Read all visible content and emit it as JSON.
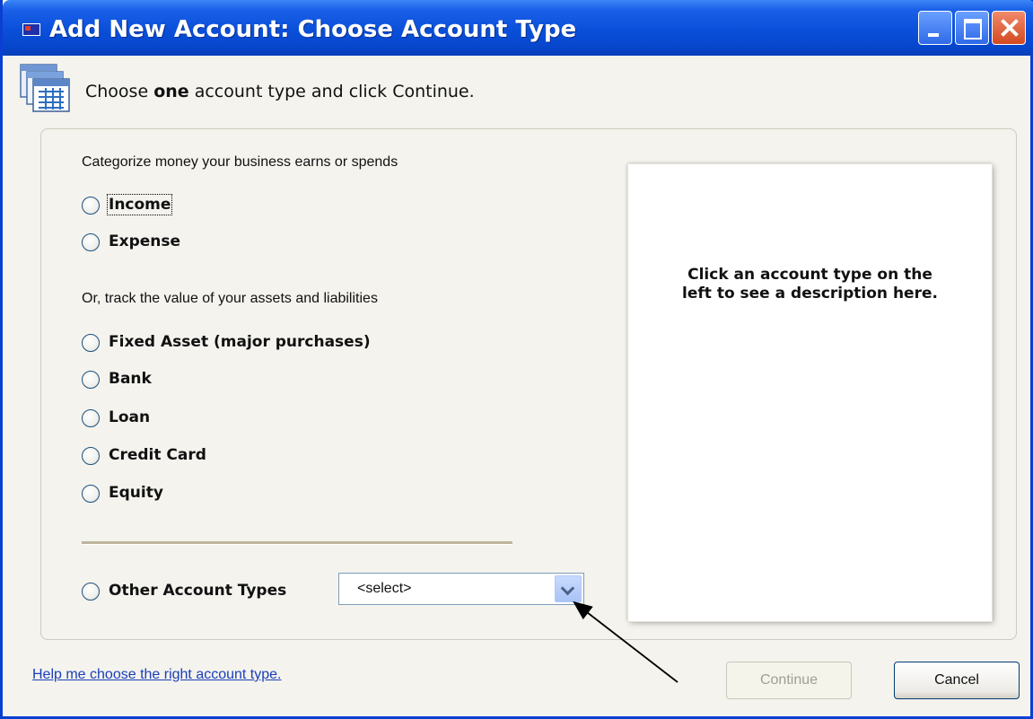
{
  "window": {
    "title": "Add New Account: Choose Account Type"
  },
  "header": {
    "prefix": "Choose ",
    "emphasis": "one",
    "suffix": " account type and click Continue."
  },
  "sections": {
    "earns_spends": "Categorize money your business earns or spends",
    "assets_liabilities": "Or, track the value of your assets and liabilities"
  },
  "account_types": {
    "income": "Income",
    "expense": "Expense",
    "fixed_asset": "Fixed Asset (major purchases)",
    "bank": "Bank",
    "loan": "Loan",
    "credit_card": "Credit Card",
    "equity": "Equity",
    "other": "Other Account Types"
  },
  "other_select": {
    "value": "<select>"
  },
  "description": {
    "line1": "Click an account type on the",
    "line2": "left to see a description here."
  },
  "footer": {
    "help_link": "Help me choose the right account type.",
    "continue": "Continue",
    "cancel": "Cancel"
  },
  "colors": {
    "titlebar": "#0a4fd9",
    "window_bg": "#f4f3ee",
    "link": "#1a3fb8",
    "disabled_text": "#a19f93"
  },
  "icons": [
    "app-icon",
    "account-list-icon",
    "minimize-icon",
    "maximize-icon",
    "close-icon",
    "dropdown-arrow-icon"
  ]
}
